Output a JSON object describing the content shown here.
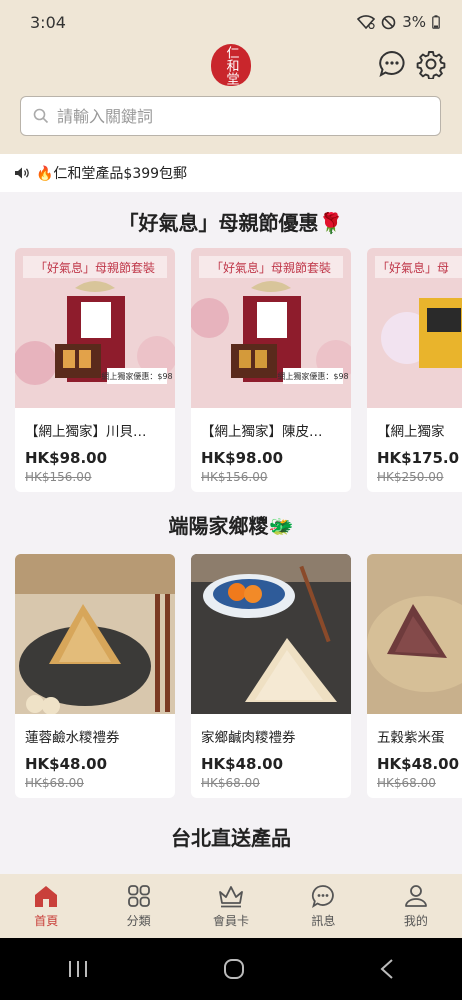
{
  "status": {
    "time": "3:04",
    "battery": "3%"
  },
  "header": {
    "logo_text": "仁和堂",
    "search_placeholder": "請輸入關鍵詞"
  },
  "announcement": {
    "text": "🔥仁和堂產品$399包郵"
  },
  "sections": [
    {
      "title": "「好氣息」母親節優惠🌹",
      "products": [
        {
          "name": "【網上獨家】川貝…",
          "price": "HK$98.00",
          "original": "HK$156.00",
          "banner": "「好氣息」母親節套裝",
          "promo": "網上獨家優惠：$98"
        },
        {
          "name": "【網上獨家】陳皮…",
          "price": "HK$98.00",
          "original": "HK$156.00",
          "banner": "「好氣息」母親節套裝",
          "promo": "網上獨家優惠：$98"
        },
        {
          "name": "【網上獨家",
          "price": "HK$175.0",
          "original": "HK$250.00",
          "banner": "「好氣息」母",
          "promo": ""
        }
      ]
    },
    {
      "title": "端陽家鄉糭🐲",
      "products": [
        {
          "name": "蓮蓉鹼水糭禮券",
          "price": "HK$48.00",
          "original": "HK$68.00"
        },
        {
          "name": "家鄉鹹肉糭禮券",
          "price": "HK$48.00",
          "original": "HK$68.00"
        },
        {
          "name": "五穀紫米蛋",
          "price": "HK$48.00",
          "original": "HK$68.00"
        }
      ]
    },
    {
      "title": "台北直送產品",
      "products": []
    }
  ],
  "nav": [
    {
      "label": "首頁",
      "icon": "home-icon",
      "active": true
    },
    {
      "label": "分類",
      "icon": "category-icon",
      "active": false
    },
    {
      "label": "會員卡",
      "icon": "crown-icon",
      "active": false
    },
    {
      "label": "訊息",
      "icon": "message-icon",
      "active": false
    },
    {
      "label": "我的",
      "icon": "user-icon",
      "active": false
    }
  ],
  "colors": {
    "header_bg": "#efe6d6",
    "accent": "#c9403b",
    "logo_red": "#c9262c"
  }
}
